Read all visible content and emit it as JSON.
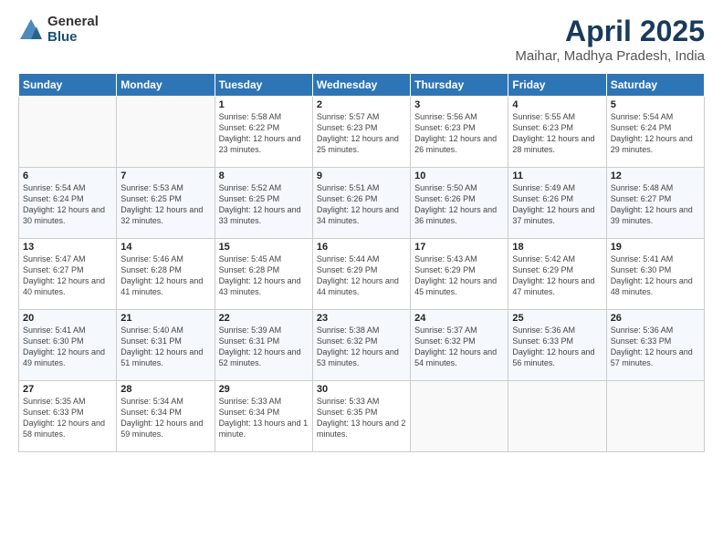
{
  "logo": {
    "general": "General",
    "blue": "Blue"
  },
  "header": {
    "title": "April 2025",
    "subtitle": "Maihar, Madhya Pradesh, India"
  },
  "weekdays": [
    "Sunday",
    "Monday",
    "Tuesday",
    "Wednesday",
    "Thursday",
    "Friday",
    "Saturday"
  ],
  "weeks": [
    [
      {
        "day": "",
        "sunrise": "",
        "sunset": "",
        "daylight": ""
      },
      {
        "day": "",
        "sunrise": "",
        "sunset": "",
        "daylight": ""
      },
      {
        "day": "1",
        "sunrise": "Sunrise: 5:58 AM",
        "sunset": "Sunset: 6:22 PM",
        "daylight": "Daylight: 12 hours and 23 minutes."
      },
      {
        "day": "2",
        "sunrise": "Sunrise: 5:57 AM",
        "sunset": "Sunset: 6:23 PM",
        "daylight": "Daylight: 12 hours and 25 minutes."
      },
      {
        "day": "3",
        "sunrise": "Sunrise: 5:56 AM",
        "sunset": "Sunset: 6:23 PM",
        "daylight": "Daylight: 12 hours and 26 minutes."
      },
      {
        "day": "4",
        "sunrise": "Sunrise: 5:55 AM",
        "sunset": "Sunset: 6:23 PM",
        "daylight": "Daylight: 12 hours and 28 minutes."
      },
      {
        "day": "5",
        "sunrise": "Sunrise: 5:54 AM",
        "sunset": "Sunset: 6:24 PM",
        "daylight": "Daylight: 12 hours and 29 minutes."
      }
    ],
    [
      {
        "day": "6",
        "sunrise": "Sunrise: 5:54 AM",
        "sunset": "Sunset: 6:24 PM",
        "daylight": "Daylight: 12 hours and 30 minutes."
      },
      {
        "day": "7",
        "sunrise": "Sunrise: 5:53 AM",
        "sunset": "Sunset: 6:25 PM",
        "daylight": "Daylight: 12 hours and 32 minutes."
      },
      {
        "day": "8",
        "sunrise": "Sunrise: 5:52 AM",
        "sunset": "Sunset: 6:25 PM",
        "daylight": "Daylight: 12 hours and 33 minutes."
      },
      {
        "day": "9",
        "sunrise": "Sunrise: 5:51 AM",
        "sunset": "Sunset: 6:26 PM",
        "daylight": "Daylight: 12 hours and 34 minutes."
      },
      {
        "day": "10",
        "sunrise": "Sunrise: 5:50 AM",
        "sunset": "Sunset: 6:26 PM",
        "daylight": "Daylight: 12 hours and 36 minutes."
      },
      {
        "day": "11",
        "sunrise": "Sunrise: 5:49 AM",
        "sunset": "Sunset: 6:26 PM",
        "daylight": "Daylight: 12 hours and 37 minutes."
      },
      {
        "day": "12",
        "sunrise": "Sunrise: 5:48 AM",
        "sunset": "Sunset: 6:27 PM",
        "daylight": "Daylight: 12 hours and 39 minutes."
      }
    ],
    [
      {
        "day": "13",
        "sunrise": "Sunrise: 5:47 AM",
        "sunset": "Sunset: 6:27 PM",
        "daylight": "Daylight: 12 hours and 40 minutes."
      },
      {
        "day": "14",
        "sunrise": "Sunrise: 5:46 AM",
        "sunset": "Sunset: 6:28 PM",
        "daylight": "Daylight: 12 hours and 41 minutes."
      },
      {
        "day": "15",
        "sunrise": "Sunrise: 5:45 AM",
        "sunset": "Sunset: 6:28 PM",
        "daylight": "Daylight: 12 hours and 43 minutes."
      },
      {
        "day": "16",
        "sunrise": "Sunrise: 5:44 AM",
        "sunset": "Sunset: 6:29 PM",
        "daylight": "Daylight: 12 hours and 44 minutes."
      },
      {
        "day": "17",
        "sunrise": "Sunrise: 5:43 AM",
        "sunset": "Sunset: 6:29 PM",
        "daylight": "Daylight: 12 hours and 45 minutes."
      },
      {
        "day": "18",
        "sunrise": "Sunrise: 5:42 AM",
        "sunset": "Sunset: 6:29 PM",
        "daylight": "Daylight: 12 hours and 47 minutes."
      },
      {
        "day": "19",
        "sunrise": "Sunrise: 5:41 AM",
        "sunset": "Sunset: 6:30 PM",
        "daylight": "Daylight: 12 hours and 48 minutes."
      }
    ],
    [
      {
        "day": "20",
        "sunrise": "Sunrise: 5:41 AM",
        "sunset": "Sunset: 6:30 PM",
        "daylight": "Daylight: 12 hours and 49 minutes."
      },
      {
        "day": "21",
        "sunrise": "Sunrise: 5:40 AM",
        "sunset": "Sunset: 6:31 PM",
        "daylight": "Daylight: 12 hours and 51 minutes."
      },
      {
        "day": "22",
        "sunrise": "Sunrise: 5:39 AM",
        "sunset": "Sunset: 6:31 PM",
        "daylight": "Daylight: 12 hours and 52 minutes."
      },
      {
        "day": "23",
        "sunrise": "Sunrise: 5:38 AM",
        "sunset": "Sunset: 6:32 PM",
        "daylight": "Daylight: 12 hours and 53 minutes."
      },
      {
        "day": "24",
        "sunrise": "Sunrise: 5:37 AM",
        "sunset": "Sunset: 6:32 PM",
        "daylight": "Daylight: 12 hours and 54 minutes."
      },
      {
        "day": "25",
        "sunrise": "Sunrise: 5:36 AM",
        "sunset": "Sunset: 6:33 PM",
        "daylight": "Daylight: 12 hours and 56 minutes."
      },
      {
        "day": "26",
        "sunrise": "Sunrise: 5:36 AM",
        "sunset": "Sunset: 6:33 PM",
        "daylight": "Daylight: 12 hours and 57 minutes."
      }
    ],
    [
      {
        "day": "27",
        "sunrise": "Sunrise: 5:35 AM",
        "sunset": "Sunset: 6:33 PM",
        "daylight": "Daylight: 12 hours and 58 minutes."
      },
      {
        "day": "28",
        "sunrise": "Sunrise: 5:34 AM",
        "sunset": "Sunset: 6:34 PM",
        "daylight": "Daylight: 12 hours and 59 minutes."
      },
      {
        "day": "29",
        "sunrise": "Sunrise: 5:33 AM",
        "sunset": "Sunset: 6:34 PM",
        "daylight": "Daylight: 13 hours and 1 minute."
      },
      {
        "day": "30",
        "sunrise": "Sunrise: 5:33 AM",
        "sunset": "Sunset: 6:35 PM",
        "daylight": "Daylight: 13 hours and 2 minutes."
      },
      {
        "day": "",
        "sunrise": "",
        "sunset": "",
        "daylight": ""
      },
      {
        "day": "",
        "sunrise": "",
        "sunset": "",
        "daylight": ""
      },
      {
        "day": "",
        "sunrise": "",
        "sunset": "",
        "daylight": ""
      }
    ]
  ]
}
